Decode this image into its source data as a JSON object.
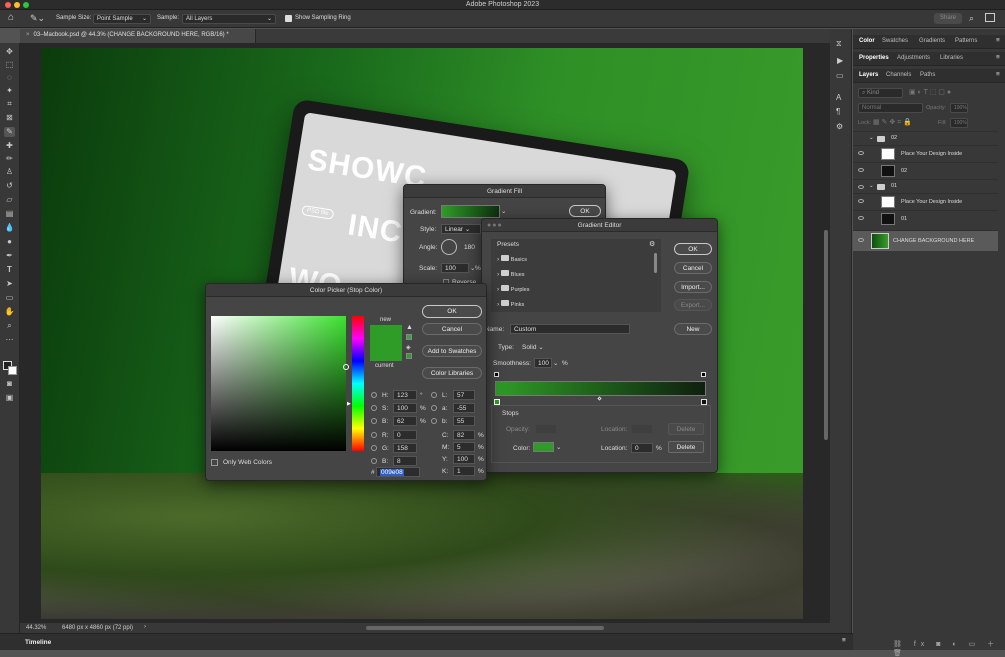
{
  "app": {
    "title": "Adobe Photoshop 2023"
  },
  "options": {
    "sample_size_label": "Sample Size:",
    "sample_size_value": "Point Sample",
    "sample_label": "Sample:",
    "sample_value": "All Layers",
    "sampling_ring": "Show Sampling Ring",
    "share": "Share"
  },
  "document": {
    "tab": "03–Macbook.psd @ 44.3% (CHANGE BACKGROUND HERE, RGB/16) *",
    "screen_text": [
      "SHOWC",
      "INCR",
      "WO"
    ],
    "badge": "PSD file"
  },
  "status": {
    "zoom": "44.32%",
    "size": "6480 px x 4860 px (72 ppi)"
  },
  "timeline": {
    "label": "Timeline"
  },
  "panels": {
    "top_tabs": [
      "Color",
      "Swatches",
      "Gradients",
      "Patterns"
    ],
    "mid_tabs": [
      "Properties",
      "Adjustments",
      "Libraries"
    ],
    "layer_tabs": [
      "Layers",
      "Channels",
      "Paths"
    ],
    "kind": "Kind",
    "blend": "Normal",
    "opacity_label": "Opacity:",
    "opacity_value": "100%",
    "lock_label": "Lock:",
    "fill_label": "Fill:",
    "fill_value": "100%",
    "layers": [
      {
        "name": "02",
        "type": "group"
      },
      {
        "name": "Place Your Design Inside",
        "type": "smart"
      },
      {
        "name": "02",
        "type": "layer"
      },
      {
        "name": "01",
        "type": "group"
      },
      {
        "name": "Place Your Design Inside",
        "type": "smart"
      },
      {
        "name": "01",
        "type": "layer"
      },
      {
        "name": "CHANGE BACKGROUND HERE",
        "type": "fill"
      }
    ]
  },
  "gradient_fill": {
    "title": "Gradient Fill",
    "gradient_label": "Gradient:",
    "ok": "OK",
    "style_label": "Style:",
    "style_value": "Linear",
    "angle_label": "Angle:",
    "angle_value": "180",
    "scale_label": "Scale:",
    "scale_value": "100",
    "pct": "%",
    "reverse": "Reverse"
  },
  "gradient_editor": {
    "title": "Gradient Editor",
    "presets_label": "Presets",
    "presets": [
      "Basics",
      "Blues",
      "Purples",
      "Pinks"
    ],
    "ok": "OK",
    "cancel": "Cancel",
    "import": "Import...",
    "export": "Export...",
    "name_label": "Name:",
    "name_value": "Custom",
    "new": "New",
    "type_label": "Type:",
    "type_value": "Solid",
    "smooth_label": "Smoothness:",
    "smooth_value": "100",
    "pct": "%",
    "stops_label": "Stops",
    "opacity_label": "Opacity:",
    "location_label": "Location:",
    "delete": "Delete",
    "color_label": "Color:",
    "color_location": "0",
    "stop_color": "#2e9c26"
  },
  "color_picker": {
    "title": "Color Picker (Stop Color)",
    "ok": "OK",
    "cancel": "Cancel",
    "add_swatches": "Add to Swatches",
    "libraries": "Color Libraries",
    "new_label": "new",
    "current_label": "current",
    "web_only": "Only Web Colors",
    "hsb": [
      {
        "k": "H:",
        "v": "123",
        "u": "°"
      },
      {
        "k": "S:",
        "v": "100",
        "u": "%"
      },
      {
        "k": "B:",
        "v": "62",
        "u": "%"
      }
    ],
    "rgb": [
      {
        "k": "R:",
        "v": "0"
      },
      {
        "k": "G:",
        "v": "158"
      },
      {
        "k": "B:",
        "v": "8"
      }
    ],
    "lab": [
      {
        "k": "L:",
        "v": "57"
      },
      {
        "k": "a:",
        "v": "-55"
      },
      {
        "k": "b:",
        "v": "55"
      }
    ],
    "cmyk": [
      {
        "k": "C:",
        "v": "82",
        "u": "%"
      },
      {
        "k": "M:",
        "v": "5",
        "u": "%"
      },
      {
        "k": "Y:",
        "v": "100",
        "u": "%"
      },
      {
        "k": "K:",
        "v": "1",
        "u": "%"
      }
    ],
    "hash": "#",
    "hex": "009e08",
    "color": "#2e9c26"
  }
}
